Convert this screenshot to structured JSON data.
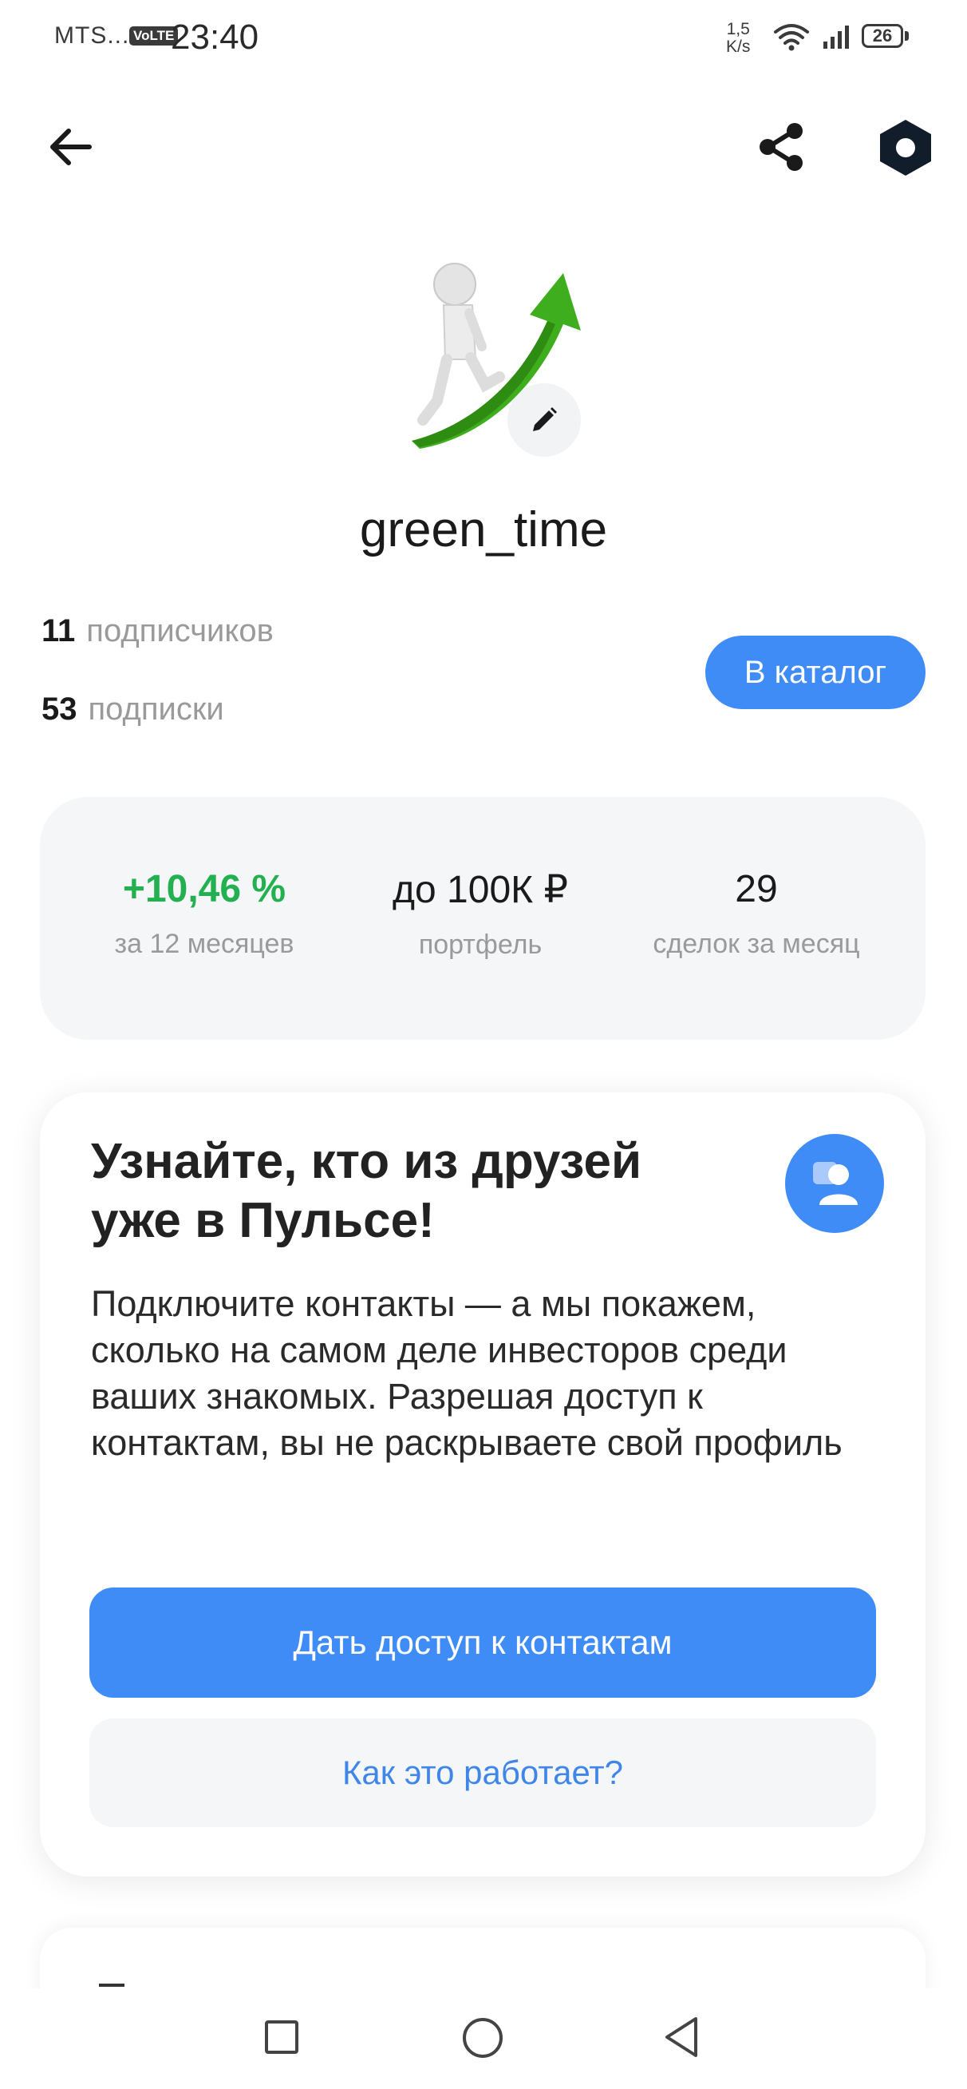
{
  "status_bar": {
    "carrier": "MTS...",
    "volte": "VoLTE",
    "time": "23:40",
    "speed_value": "1,5",
    "speed_unit": "K/s",
    "battery": "26"
  },
  "icons": {
    "back": "arrow-left-icon",
    "share": "share-icon",
    "settings": "hexagon-settings-icon",
    "edit": "pencil-icon",
    "contacts": "person-icon"
  },
  "profile": {
    "username": "green_time",
    "followers_count": "11",
    "followers_label": "подписчиков",
    "subscriptions_count": "53",
    "subscriptions_label": "подписки",
    "catalog_button": "В каталог"
  },
  "metrics": [
    {
      "value": "+10,46 %",
      "label": "за 12 месяцев"
    },
    {
      "value": "до 100К ₽",
      "label": "портфель"
    },
    {
      "value": "29",
      "label": "сделок за месяц"
    }
  ],
  "promo": {
    "title": "Узнайте, кто из друзей уже в Пульсе!",
    "text": "Подключите контакты — а мы покажем, сколько на самом деле инвесторов среди ваших знакомых. Разрешая доступ к контактам, вы не раскрываете свой профиль",
    "primary_button": "Дать доступ к контактам",
    "secondary_button": "Как это работает?"
  },
  "colors": {
    "accent": "#3f8cf7",
    "positive": "#22b050",
    "card_bg": "#f4f6f7"
  }
}
